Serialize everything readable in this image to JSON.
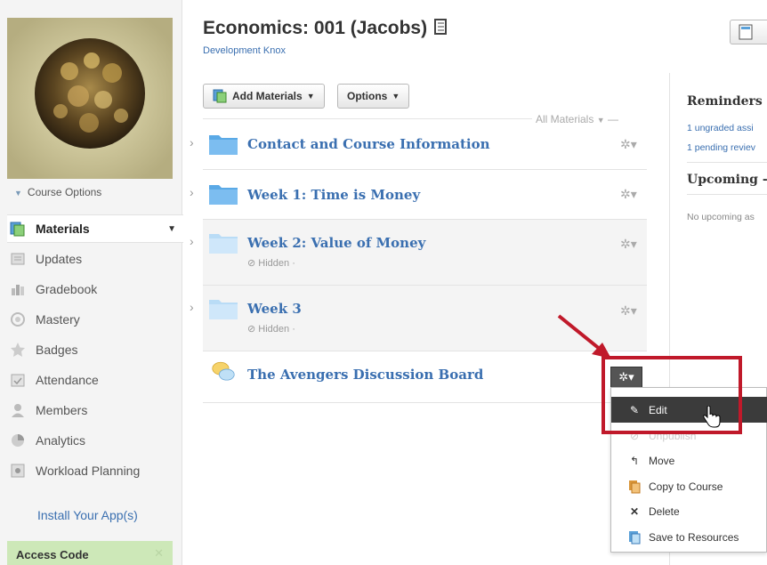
{
  "sidebar": {
    "course_options": "Course Options",
    "nav": [
      {
        "label": "Materials",
        "icon": "materials-icon"
      },
      {
        "label": "Updates",
        "icon": "updates-icon"
      },
      {
        "label": "Gradebook",
        "icon": "gradebook-icon"
      },
      {
        "label": "Mastery",
        "icon": "mastery-icon"
      },
      {
        "label": "Badges",
        "icon": "badges-icon"
      },
      {
        "label": "Attendance",
        "icon": "attendance-icon"
      },
      {
        "label": "Members",
        "icon": "members-icon"
      },
      {
        "label": "Analytics",
        "icon": "analytics-icon"
      },
      {
        "label": "Workload Planning",
        "icon": "workload-icon"
      }
    ],
    "install_app": "Install Your App(s)",
    "access_code": "Access Code"
  },
  "header": {
    "title": "Economics: 001 (Jacobs)",
    "subtitle": "Development Knox"
  },
  "toolbar": {
    "add_materials": "Add Materials",
    "options": "Options",
    "all_materials": "All Materials"
  },
  "materials": [
    {
      "name": "Contact and Course Information",
      "hidden": ""
    },
    {
      "name": "Week 1: Time is Money",
      "hidden": ""
    },
    {
      "name": "Week 2: Value of Money",
      "hidden": "⊘ Hidden ·"
    },
    {
      "name": "Week 3",
      "hidden": "⊘ Hidden ·"
    },
    {
      "name": "The Avengers Discussion Board",
      "hidden": ""
    }
  ],
  "right_panel": {
    "reminders_title": "Reminders",
    "reminder_1": "1 ungraded assi",
    "reminder_2": "1 pending reviev",
    "upcoming_title": "Upcoming",
    "upcoming_text": "No upcoming as"
  },
  "menu": {
    "items": [
      {
        "label": "Edit",
        "icon": "pencil-icon"
      },
      {
        "label": "Unpublish",
        "icon": "unpublish-icon"
      },
      {
        "label": "Move",
        "icon": "move-icon"
      },
      {
        "label": "Copy to Course",
        "icon": "copy-icon"
      },
      {
        "label": "Delete",
        "icon": "delete-icon"
      },
      {
        "label": "Save to Resources",
        "icon": "save-resources-icon"
      }
    ]
  },
  "colors": {
    "link": "#3a6fb0",
    "highlight": "#c0192a",
    "access_code_bg": "#cde8b8"
  }
}
